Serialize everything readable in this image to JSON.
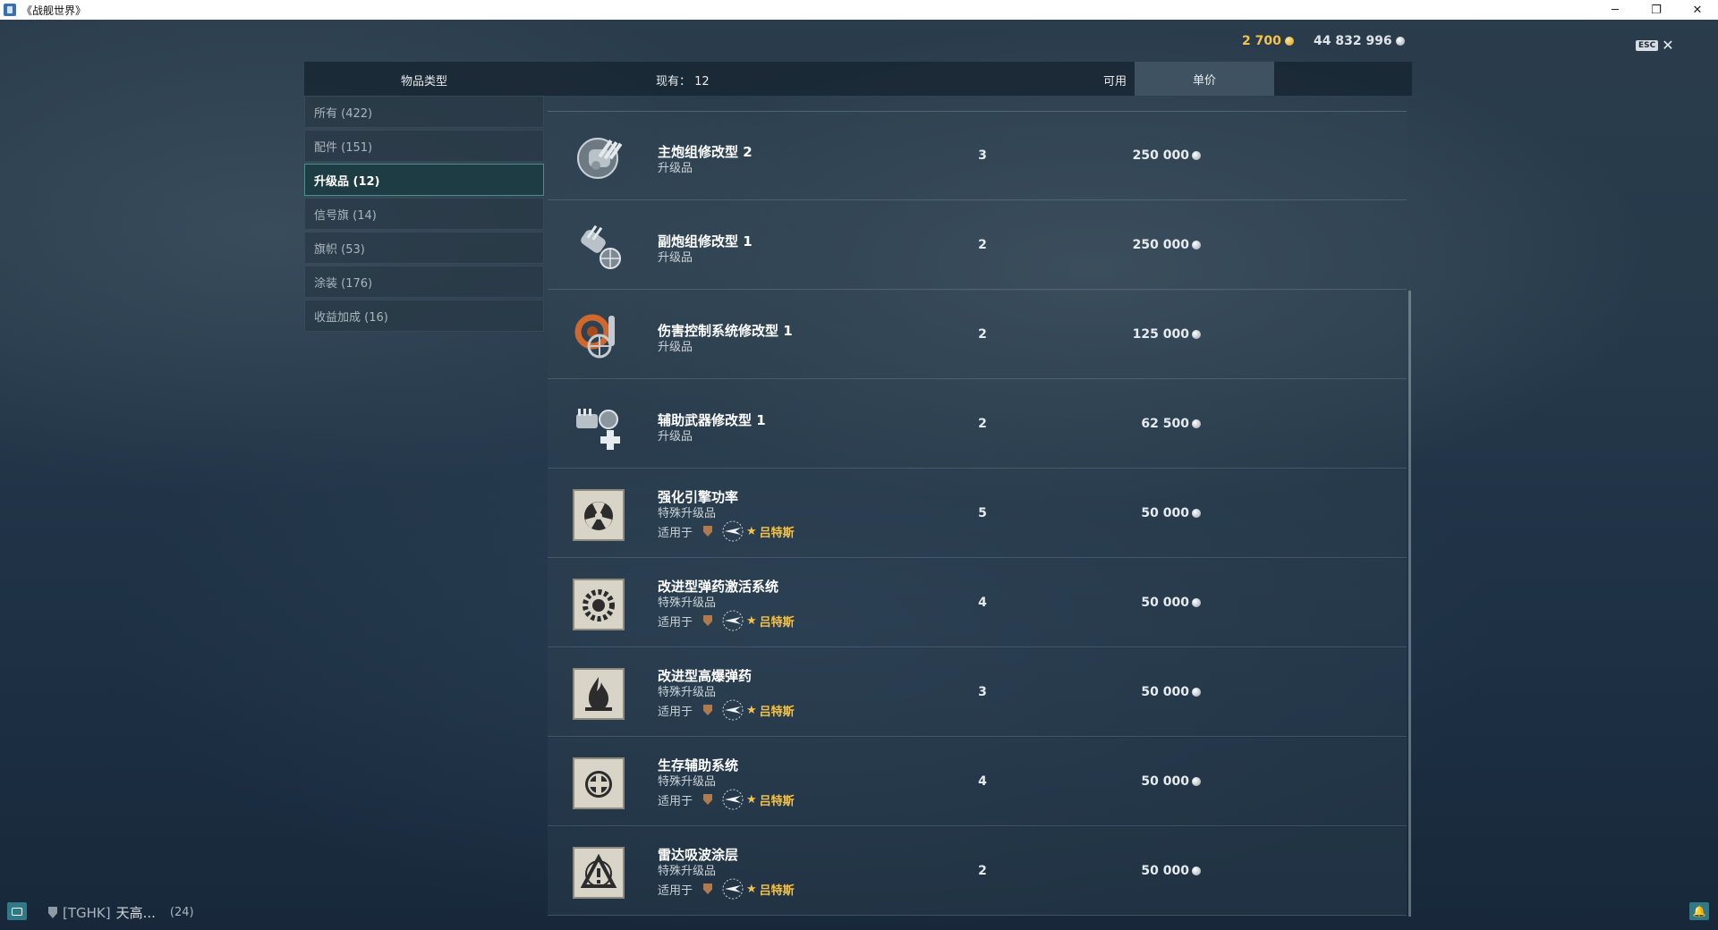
{
  "window": {
    "title": "《战舰世界》",
    "minimize": "─",
    "restore": "❐",
    "close": "✕"
  },
  "currency": {
    "gold": "2 700",
    "credits": "44 832 996"
  },
  "esc": {
    "key": "ESC",
    "close": "✕"
  },
  "header": {
    "item_type": "物品类型",
    "in_stock_label": "现有：",
    "in_stock_value": "12",
    "available": "可用",
    "unit_price": "单价"
  },
  "sidebar": {
    "items": [
      {
        "label": "所有 (422)"
      },
      {
        "label": "配件 (151)"
      },
      {
        "label": "升级品 (12)"
      },
      {
        "label": "信号旗 (14)"
      },
      {
        "label": "旗帜 (53)"
      },
      {
        "label": "涂装 (176)"
      },
      {
        "label": "收益加成 (16)"
      }
    ],
    "active_index": 2
  },
  "items": [
    {
      "name": "主炮组修改型 2",
      "type": "升级品",
      "qty": "3",
      "price": "250 000",
      "icon": "main-battery-icon"
    },
    {
      "name": "副炮组修改型 1",
      "type": "升级品",
      "qty": "2",
      "price": "250 000",
      "icon": "secondary-battery-icon"
    },
    {
      "name": "伤害控制系统修改型 1",
      "type": "升级品",
      "qty": "2",
      "price": "125 000",
      "icon": "damage-control-icon"
    },
    {
      "name": "辅助武器修改型 1",
      "type": "升级品",
      "qty": "2",
      "price": "62 500",
      "icon": "aux-armament-icon"
    },
    {
      "name": "强化引擎功率",
      "type": "特殊升级品",
      "applies_label": "适用于",
      "ship": "吕特斯",
      "qty": "5",
      "price": "50 000",
      "icon": "engine-icon"
    },
    {
      "name": "改进型弹药激活系统",
      "type": "特殊升级品",
      "applies_label": "适用于",
      "ship": "吕特斯",
      "qty": "4",
      "price": "50 000",
      "icon": "ammo-activation-icon"
    },
    {
      "name": "改进型高爆弹药",
      "type": "特殊升级品",
      "applies_label": "适用于",
      "ship": "吕特斯",
      "qty": "3",
      "price": "50 000",
      "icon": "he-ammo-icon"
    },
    {
      "name": "生存辅助系统",
      "type": "特殊升级品",
      "applies_label": "适用于",
      "ship": "吕特斯",
      "qty": "4",
      "price": "50 000",
      "icon": "survivability-icon"
    },
    {
      "name": "雷达吸波涂层",
      "type": "特殊升级品",
      "applies_label": "适用于",
      "ship": "吕特斯",
      "qty": "2",
      "price": "50 000",
      "icon": "radar-absorbent-icon"
    }
  ],
  "player": {
    "clan": "[TGHK]",
    "name": "天高...",
    "level": "(24)"
  },
  "colors": {
    "gold": "#f5c34a",
    "active_border": "#4a8f8a",
    "chat_button": "#2f7a86"
  }
}
